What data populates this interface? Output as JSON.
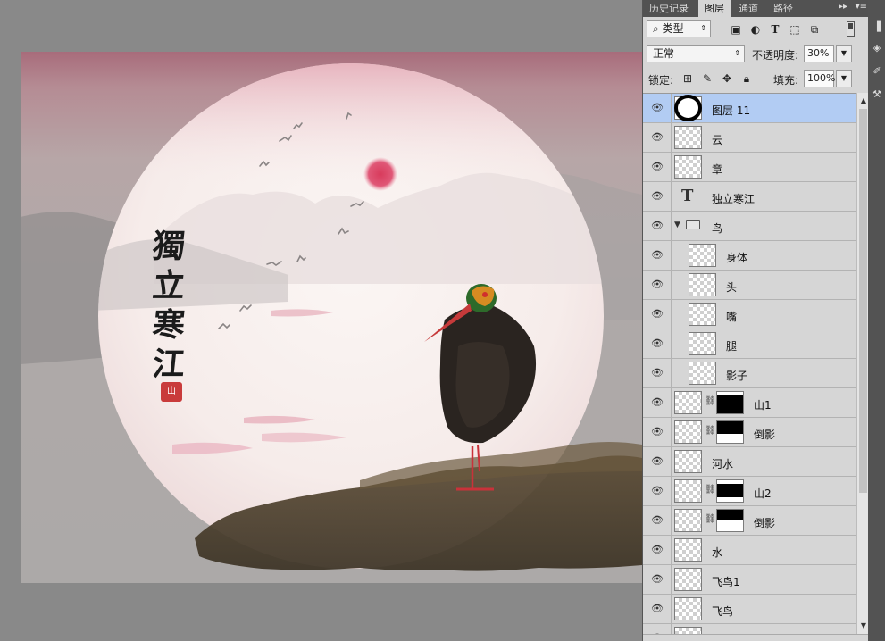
{
  "panel_tabs": [
    {
      "label": "历史记录",
      "active": false
    },
    {
      "label": "图层",
      "active": true
    },
    {
      "label": "通道",
      "active": false
    },
    {
      "label": "路径",
      "active": false
    }
  ],
  "panel_controls": {
    "expand_icon": "double-right-arrow-icon",
    "menu_icon": "panel-menu-icon"
  },
  "filter": {
    "search_icon": "search-icon",
    "kind_value": "类型"
  },
  "filter_icons": [
    "image-filter-icon",
    "adjustment-filter-icon",
    "type-filter-icon",
    "shape-filter-icon",
    "smart-object-filter-icon"
  ],
  "blend": {
    "mode": "正常",
    "opacity_label": "不透明度:",
    "opacity_value": "30%"
  },
  "lock": {
    "label": "锁定:",
    "icons": [
      "lock-transparent-icon",
      "lock-brush-icon",
      "lock-move-icon",
      "lock-all-icon"
    ],
    "fill_label": "填充:",
    "fill_value": "100%"
  },
  "layers": [
    {
      "name": "图层 11",
      "kind": "circle",
      "selected": true
    },
    {
      "name": "云",
      "kind": "pixel"
    },
    {
      "name": "章",
      "kind": "pixel"
    },
    {
      "name": "独立寒江",
      "kind": "text"
    },
    {
      "name": "鸟",
      "kind": "group"
    },
    {
      "name": "身体",
      "kind": "child"
    },
    {
      "name": "头",
      "kind": "child"
    },
    {
      "name": "嘴",
      "kind": "child"
    },
    {
      "name": "腿",
      "kind": "child"
    },
    {
      "name": "影子",
      "kind": "child"
    },
    {
      "name": "山1",
      "kind": "masked",
      "mask_black_top": 0.15,
      "mask_black_height": 0.85
    },
    {
      "name": "倒影",
      "kind": "masked",
      "mask_black_top": 0.0,
      "mask_black_height": 0.6
    },
    {
      "name": "河水",
      "kind": "pixel"
    },
    {
      "name": "山2",
      "kind": "masked",
      "mask_black_top": 0.15,
      "mask_black_height": 0.65
    },
    {
      "name": "倒影",
      "kind": "masked",
      "mask_black_top": 0.0,
      "mask_black_height": 0.45
    },
    {
      "name": "水",
      "kind": "pixel"
    },
    {
      "name": "飞鸟1",
      "kind": "pixel"
    },
    {
      "name": "飞鸟",
      "kind": "pixel"
    },
    {
      "name": "",
      "kind": "pixel"
    }
  ],
  "artwork": {
    "calligraphy": [
      "獨",
      "立",
      "寒",
      "江"
    ],
    "seal": "山",
    "colors": {
      "sky_top": "#a86c7b",
      "circle": "#f7eeec",
      "sun": "#d83b5c",
      "ground": "#4a3e2a",
      "beak": "#c63a3a"
    }
  },
  "selected_layer_color": "#b2ccf3"
}
